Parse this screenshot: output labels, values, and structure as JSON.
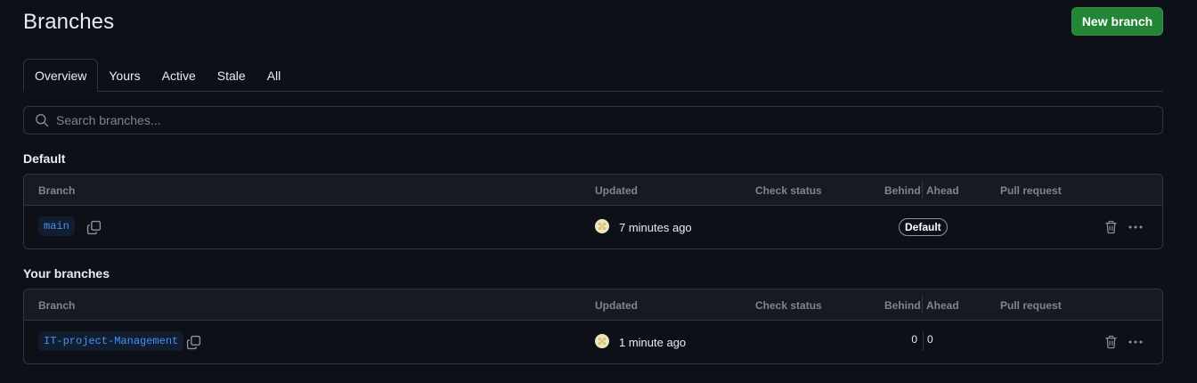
{
  "page": {
    "title": "Branches",
    "new_branch_label": "New branch"
  },
  "tabs": [
    {
      "label": "Overview",
      "selected": true
    },
    {
      "label": "Yours"
    },
    {
      "label": "Active"
    },
    {
      "label": "Stale"
    },
    {
      "label": "All"
    }
  ],
  "search": {
    "placeholder": "Search branches..."
  },
  "columns": {
    "branch": "Branch",
    "updated": "Updated",
    "check_status": "Check status",
    "behind": "Behind",
    "ahead": "Ahead",
    "pull_request": "Pull request"
  },
  "default_section": {
    "heading": "Default",
    "rows": [
      {
        "name": "main",
        "updated": "7 minutes ago",
        "badge": "Default"
      }
    ]
  },
  "your_section": {
    "heading": "Your branches",
    "rows": [
      {
        "name": "IT-project-Management",
        "updated": "1 minute ago",
        "behind": "0",
        "ahead": "0"
      }
    ]
  },
  "icons": {
    "search": "search-icon",
    "copy": "copy-icon",
    "trash": "trash-icon",
    "more": "kebab-horizontal-icon"
  },
  "colors": {
    "background": "#0d1117",
    "primary_button": "#238636",
    "branch_link": "#4493f8",
    "muted_text": "#7d8590",
    "border": "#30363d"
  }
}
